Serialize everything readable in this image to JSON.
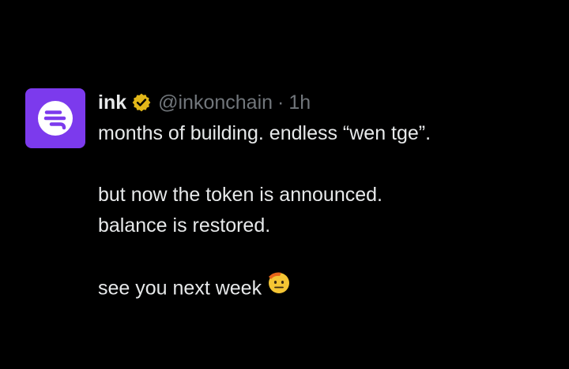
{
  "post": {
    "display_name": "ink",
    "handle": "@inkonchain",
    "separator": "·",
    "time": "1h",
    "lines": [
      "months of building. endless “wen tge”.",
      "but now the token is announced.",
      "balance is restored.",
      "see you next week"
    ],
    "avatar_color": "#7c3aed",
    "verified_badge_color": "#e2b719",
    "emoji": "saluting-face-icon"
  }
}
